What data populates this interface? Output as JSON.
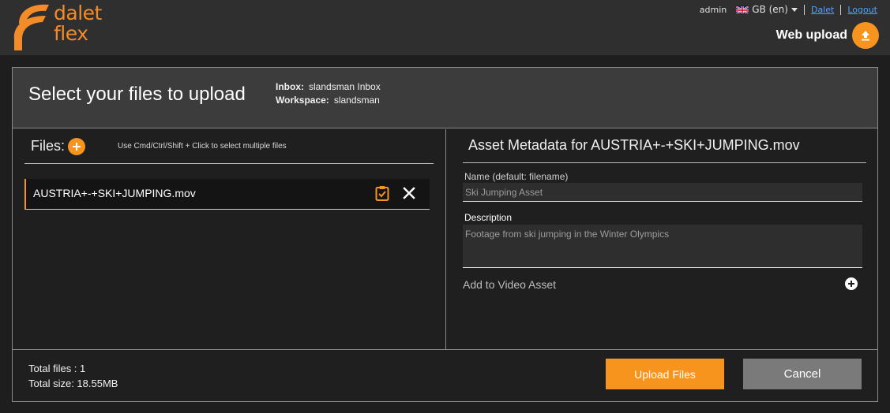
{
  "brand": {
    "line1": "dalet",
    "line2": "flex",
    "accent": "#f7941d"
  },
  "user_bar": {
    "username": "admin",
    "language": "GB (en)",
    "link1": "Dalet",
    "link2": "Logout"
  },
  "web_upload": {
    "label": "Web upload",
    "icon": "upload-arrow-icon"
  },
  "header": {
    "title": "Select your files to upload",
    "inbox_label": "Inbox:",
    "inbox_value": "slandsman Inbox",
    "workspace_label": "Workspace:",
    "workspace_value": "slandsman"
  },
  "files": {
    "label": "Files:",
    "hint": "Use Cmd/Ctrl/Shift + Click to select multiple files",
    "items": [
      {
        "name": "AUSTRIA+-+SKI+JUMPING.mov"
      }
    ]
  },
  "metadata": {
    "title": "Asset Metadata for AUSTRIA+-+SKI+JUMPING.mov",
    "name_label": "Name (default: filename)",
    "name_value": "Ski Jumping Asset",
    "description_label": "Description",
    "description_value": "Footage from ski jumping in the Winter Olympics",
    "add_video_label": "Add to Video Asset"
  },
  "footer": {
    "total_files": "Total files : 1",
    "total_size": "Total size: 18.55MB",
    "upload_label": "Upload Files",
    "cancel_label": "Cancel"
  }
}
